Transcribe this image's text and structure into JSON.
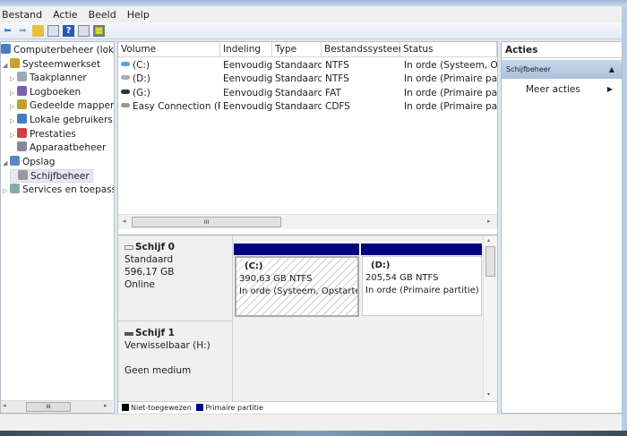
{
  "menu": [
    "Bestand",
    "Actie",
    "Beeld",
    "Help"
  ],
  "tree": [
    {
      "label": "Computerbeheer (lokaal)",
      "level": 0,
      "icon": "computer-icon",
      "exp": ""
    },
    {
      "label": "Systeemwerkset",
      "level": 1,
      "icon": "tools-icon",
      "exp": "◢"
    },
    {
      "label": "Taakplanner",
      "level": 2,
      "icon": "clock-icon",
      "exp": "▷"
    },
    {
      "label": "Logboeken",
      "level": 2,
      "icon": "log-icon",
      "exp": "▷"
    },
    {
      "label": "Gedeelde mappen",
      "level": 2,
      "icon": "shared-folder-icon",
      "exp": "▷"
    },
    {
      "label": "Lokale gebruikers en groepen",
      "level": 2,
      "icon": "users-icon",
      "exp": "▷"
    },
    {
      "label": "Prestaties",
      "level": 2,
      "icon": "performance-icon",
      "exp": "▷"
    },
    {
      "label": "Apparaatbeheer",
      "level": 2,
      "icon": "device-manager-icon",
      "exp": ""
    },
    {
      "label": "Opslag",
      "level": 1,
      "icon": "storage-icon",
      "exp": "◢"
    },
    {
      "label": "Schijfbeheer",
      "level": 2,
      "icon": "disk-management-icon",
      "exp": "",
      "selected": true
    },
    {
      "label": "Services en toepassingen",
      "level": 1,
      "icon": "services-icon",
      "exp": "▷"
    }
  ],
  "volumes": {
    "headers": [
      "Volume",
      "Indeling",
      "Type",
      "Bestandssysteem",
      "Status"
    ],
    "rows": [
      [
        "(C:)",
        "Eenvoudig",
        "Standaard",
        "NTFS",
        "In orde (Systeem, Opstarten)"
      ],
      [
        "(D:)",
        "Eenvoudig",
        "Standaard",
        "NTFS",
        "In orde (Primaire partitie)"
      ],
      [
        "(G:)",
        "Eenvoudig",
        "Standaard",
        "FAT",
        "In orde (Primaire partitie)"
      ],
      [
        "Easy Connection (F:)",
        "Eenvoudig",
        "Standaard",
        "CDFS",
        "In orde (Primaire partitie)"
      ]
    ]
  },
  "disks": [
    {
      "name": "Schijf 0",
      "type": "Standaard",
      "size": "596,17 GB",
      "state": "Online",
      "partitions": [
        {
          "name": "(C:)",
          "size": "390,63 GB NTFS",
          "status": "In orde (Systeem, Opstarten)"
        },
        {
          "name": "(D:)",
          "size": "205,54 GB NTFS",
          "status": "In orde (Primaire partitie)"
        }
      ]
    },
    {
      "name": "Schijf 1",
      "type": "Verwisselbaar (H:)",
      "state": "Geen medium"
    }
  ],
  "legend": [
    {
      "label": "Niet-toegewezen",
      "color": "#000000"
    },
    {
      "label": "Primaire partitie",
      "color": "#000080"
    }
  ],
  "actions": {
    "title": "Acties",
    "section": "Schijfbeheer",
    "more": "Meer acties"
  },
  "scroll_thumb": "III"
}
